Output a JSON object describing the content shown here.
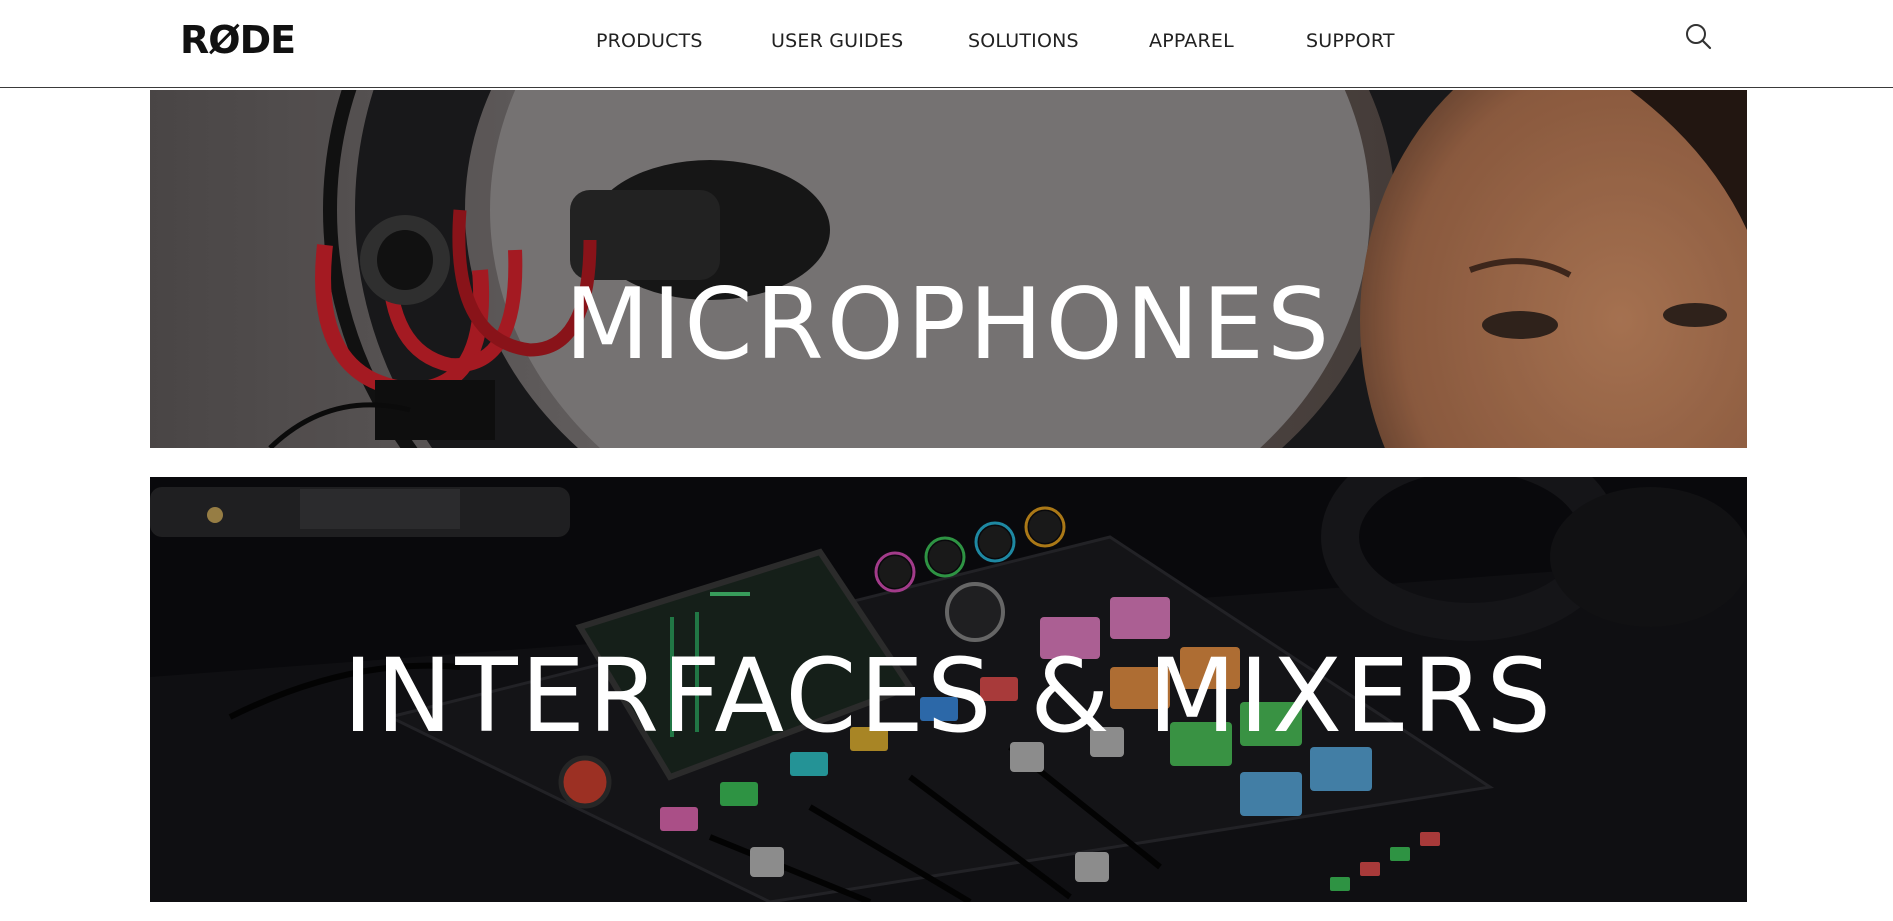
{
  "header": {
    "logo": "RØDE",
    "nav": [
      {
        "label": "PRODUCTS"
      },
      {
        "label": "USER GUIDES"
      },
      {
        "label": "SOLUTIONS"
      },
      {
        "label": "APPAREL"
      },
      {
        "label": "SUPPORT"
      }
    ],
    "search_icon": "search-icon"
  },
  "banners": [
    {
      "title": "MICROPHONES"
    },
    {
      "title": "INTERFACES & MIXERS"
    }
  ],
  "colors": {
    "header_bg": "#ffffff",
    "nav_text": "#222222",
    "banner_text": "#ffffff",
    "mic_accent": "#c8202a"
  }
}
